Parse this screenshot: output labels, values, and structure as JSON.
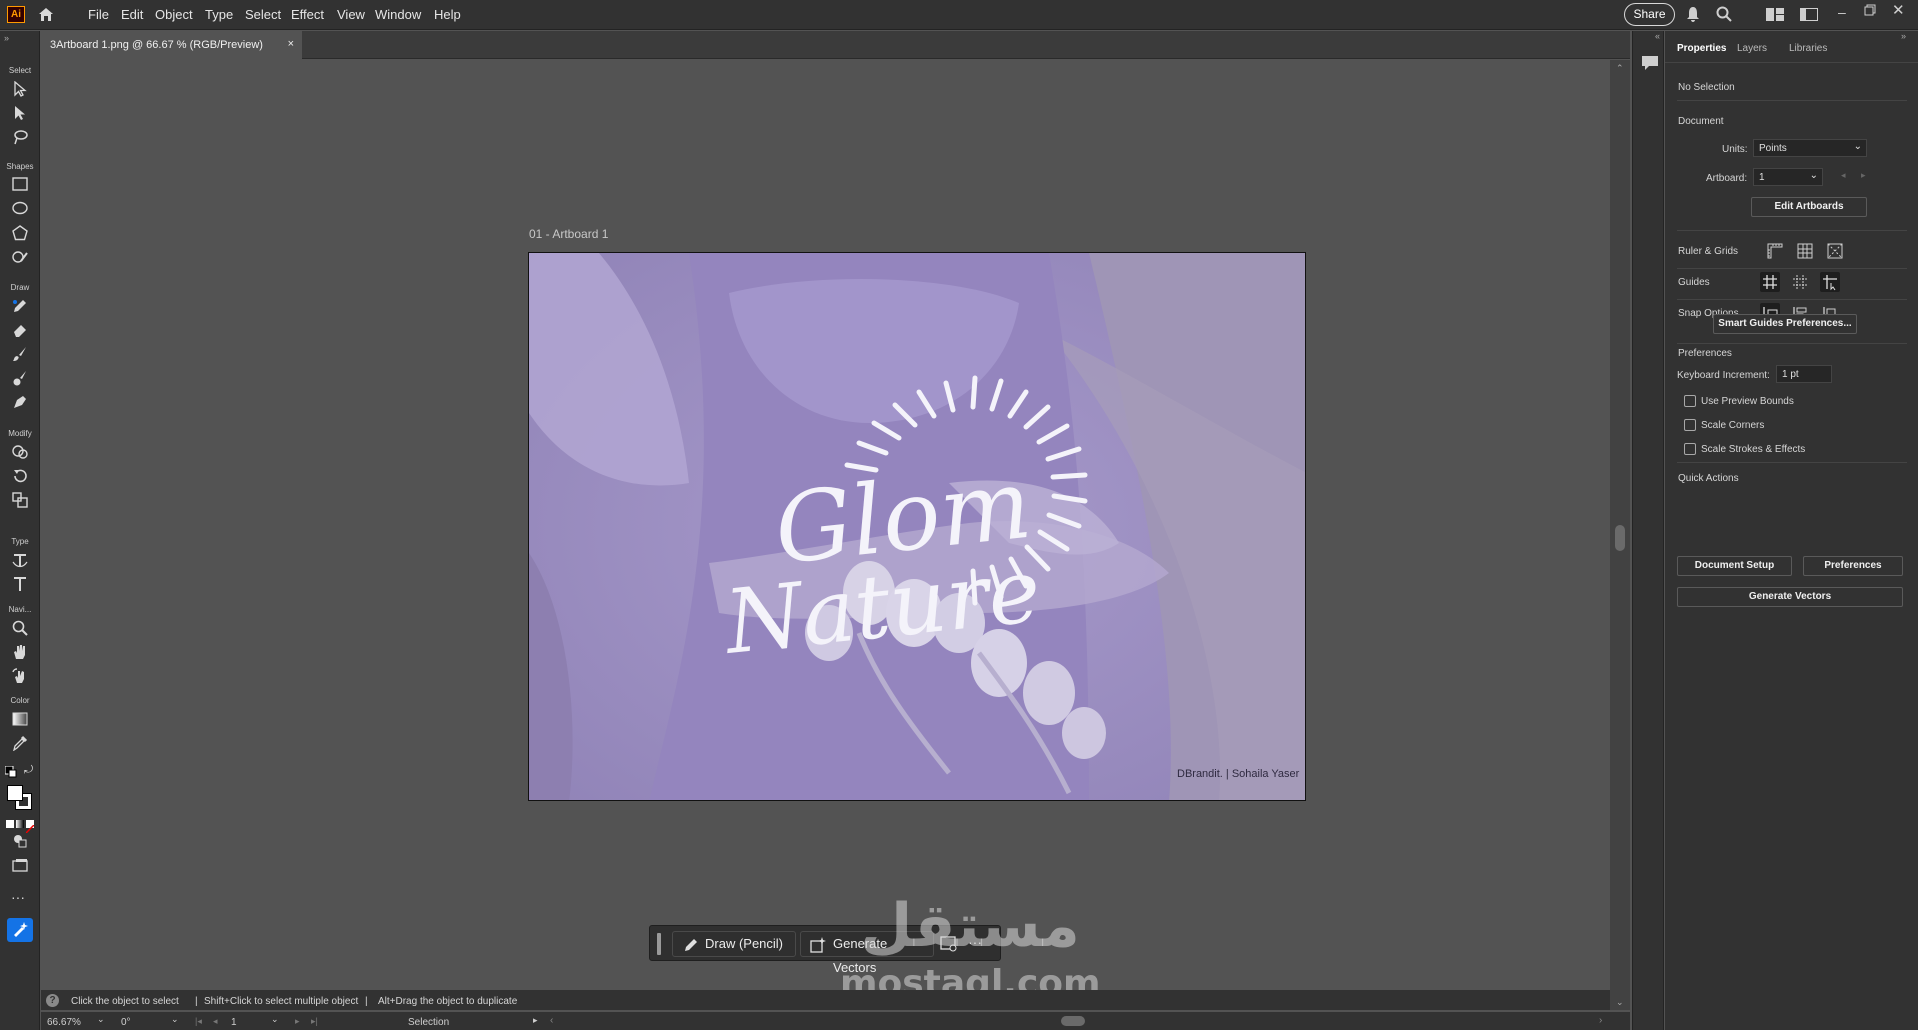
{
  "app": {
    "logo": "Ai"
  },
  "menu": [
    "File",
    "Edit",
    "Object",
    "Type",
    "Select",
    "Effect",
    "View",
    "Window",
    "Help"
  ],
  "header_right": {
    "share_label": "Share"
  },
  "document": {
    "tab_title": "3Artboard 1.png @ 66.67 % (RGB/Preview)",
    "close_glyph": "×"
  },
  "toolbar": {
    "sections": [
      "Select",
      "Shapes",
      "Draw",
      "Modify",
      "Type",
      "Navi...",
      "Color"
    ]
  },
  "artboard": {
    "label": "01 - Artboard 1",
    "artwork_line1": "Glom",
    "artwork_line2": "Nature",
    "credit": "DBrandit. | Sohaila Yaser"
  },
  "floating_bar": {
    "draw_label": "Draw (Pencil)",
    "generate_label": "Generate Vectors",
    "more_label": "···"
  },
  "watermark": {
    "arabic": "مستقل",
    "latin": "mostaql.com"
  },
  "status": {
    "hint1": "Click the object to select",
    "hint2": "Shift+Click to select multiple object",
    "hint3": "Alt+Drag the object to duplicate",
    "separator": "|"
  },
  "bottom": {
    "zoom": "66.67%",
    "rotation": "0°",
    "artboard_num": "1",
    "tool_mode": "Selection"
  },
  "panel": {
    "tabs": [
      "Properties",
      "Layers",
      "Libraries"
    ],
    "no_selection": "No Selection",
    "document_heading": "Document",
    "units_label": "Units:",
    "units_value": "Points",
    "artboard_label": "Artboard:",
    "artboard_value": "1",
    "edit_artboards": "Edit Artboards",
    "ruler_grids": "Ruler & Grids",
    "guides": "Guides",
    "snap_options": "Snap Options",
    "smart_guides_btn": "Smart Guides Preferences...",
    "preferences_heading": "Preferences",
    "keyboard_increment_label": "Keyboard Increment:",
    "keyboard_increment_value": "1 pt",
    "chk_preview_bounds": "Use Preview Bounds",
    "chk_scale_corners": "Scale Corners",
    "chk_scale_strokes": "Scale Strokes & Effects",
    "quick_actions": "Quick Actions",
    "document_setup_btn": "Document Setup",
    "preferences_btn": "Preferences",
    "generate_vectors_btn": "Generate Vectors"
  },
  "colors": {
    "chrome_dark": "#323232",
    "canvas": "#535353",
    "artwork_overlay": "#9b8fbf",
    "accent_blue": "#1473e6"
  }
}
